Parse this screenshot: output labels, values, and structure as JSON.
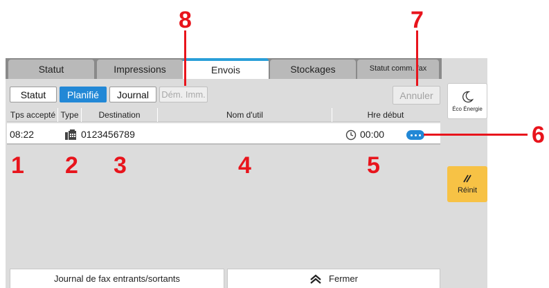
{
  "callouts": {
    "c1": "1",
    "c2": "2",
    "c3": "3",
    "c4": "4",
    "c5": "5",
    "c6": "6",
    "c7": "7",
    "c8": "8"
  },
  "tabs": [
    {
      "label": "Statut"
    },
    {
      "label": "Impressions"
    },
    {
      "label": "Envois"
    },
    {
      "label": "Stockages"
    },
    {
      "label": "Statut comm. fax"
    }
  ],
  "subtabs": {
    "statut": "Statut",
    "planifie": "Planifié",
    "journal": "Journal",
    "dem_imm": "Dém. Imm."
  },
  "cancel_label": "Annuler",
  "columns": {
    "accepted_time": "Tps accepté",
    "type": "Type",
    "destination": "Destination",
    "user_name": "Nom d'util",
    "start_time": "Hre début"
  },
  "rows": [
    {
      "accepted_time": "08:22",
      "type_icon": "fax-icon",
      "destination": "0123456789",
      "user_name": "",
      "start_icon": "clock-icon",
      "start_time": "00:00",
      "more_icon": "more-icon"
    }
  ],
  "bottom": {
    "fax_log": "Journal de fax entrants/sortants",
    "close": "Fermer",
    "close_icon": "double-chevron-up-icon"
  },
  "side": {
    "eco_label": "Éco Énergie",
    "eco_icon": "moon-icon",
    "reset_label": "Réinit",
    "reset_icon": "reset-slash-icon"
  },
  "colors": {
    "active_tab_accent": "#2a9fd8",
    "active_subtab": "#2288d6",
    "reset_button": "#f7c245",
    "callout": "#e8141c",
    "more_button": "#2288d6"
  }
}
